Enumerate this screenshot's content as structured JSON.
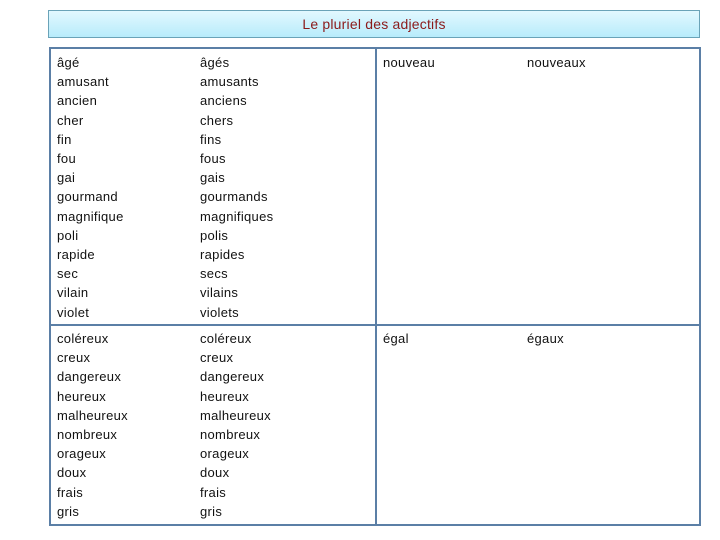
{
  "title": "Le pluriel des adjectifs",
  "colors": {
    "title_text": "#8b1a1a",
    "banner_top": "#e2f8ff",
    "banner_bottom": "#b8ecfb",
    "table_border": "#5b7fa6"
  },
  "sections": [
    {
      "left": {
        "singular": [
          "âgé",
          "amusant",
          "ancien",
          "cher",
          "fin",
          "fou",
          "gai",
          "gourmand",
          "magnifique",
          "poli",
          "rapide",
          "sec",
          "vilain",
          "violet"
        ],
        "plural": [
          "âgés",
          "amusants",
          "anciens",
          "chers",
          "fins",
          "fous",
          "gais",
          "gourmands",
          "magnifiques",
          "polis",
          "rapides",
          "secs",
          "vilains",
          "violets"
        ]
      },
      "right": {
        "singular": [
          "nouveau"
        ],
        "plural": [
          "nouveaux"
        ]
      }
    },
    {
      "left": {
        "singular": [
          "coléreux",
          "creux",
          "dangereux",
          "heureux",
          "malheureux",
          "nombreux",
          "orageux",
          "doux",
          "frais",
          "gris"
        ],
        "plural": [
          "coléreux",
          "creux",
          "dangereux",
          "heureux",
          "malheureux",
          "nombreux",
          "orageux",
          "doux",
          "frais",
          "gris"
        ]
      },
      "right": {
        "singular": [
          "égal"
        ],
        "plural": [
          "égaux"
        ]
      }
    }
  ]
}
